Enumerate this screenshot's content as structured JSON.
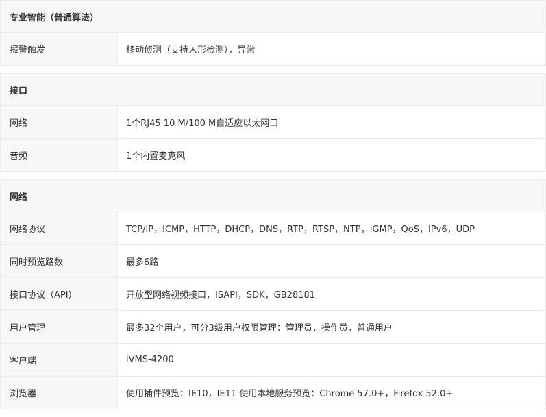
{
  "sections": [
    {
      "title": "专业智能（普通算法）",
      "rows": [
        {
          "label": "报警触发",
          "value": "移动侦测（支持人形检测），异常"
        }
      ]
    },
    {
      "title": "接口",
      "rows": [
        {
          "label": "网络",
          "value": "1个RJ45 10 M/100 M自适应以太网口"
        },
        {
          "label": "音频",
          "value": "1个内置麦克风"
        }
      ]
    },
    {
      "title": "网络",
      "rows": [
        {
          "label": "网络协议",
          "value": "TCP/IP，ICMP，HTTP，DHCP，DNS，RTP，RTSP，NTP，IGMP，QoS，IPv6，UDP"
        },
        {
          "label": "同时预览路数",
          "value": "最多6路"
        },
        {
          "label": "接口协议（API）",
          "value": "开放型网络视频接口，ISAPI，SDK，GB28181"
        },
        {
          "label": "用户管理",
          "value": "最多32个用户，可分3级用户权限管理：管理员，操作员，普通用户"
        },
        {
          "label": "客户端",
          "value": "iVMS-4200"
        },
        {
          "label": "浏览器",
          "value": "使用插件预览：IE10，IE11 使用本地服务预览：Chrome 57.0+，Firefox 52.0+"
        }
      ]
    }
  ]
}
